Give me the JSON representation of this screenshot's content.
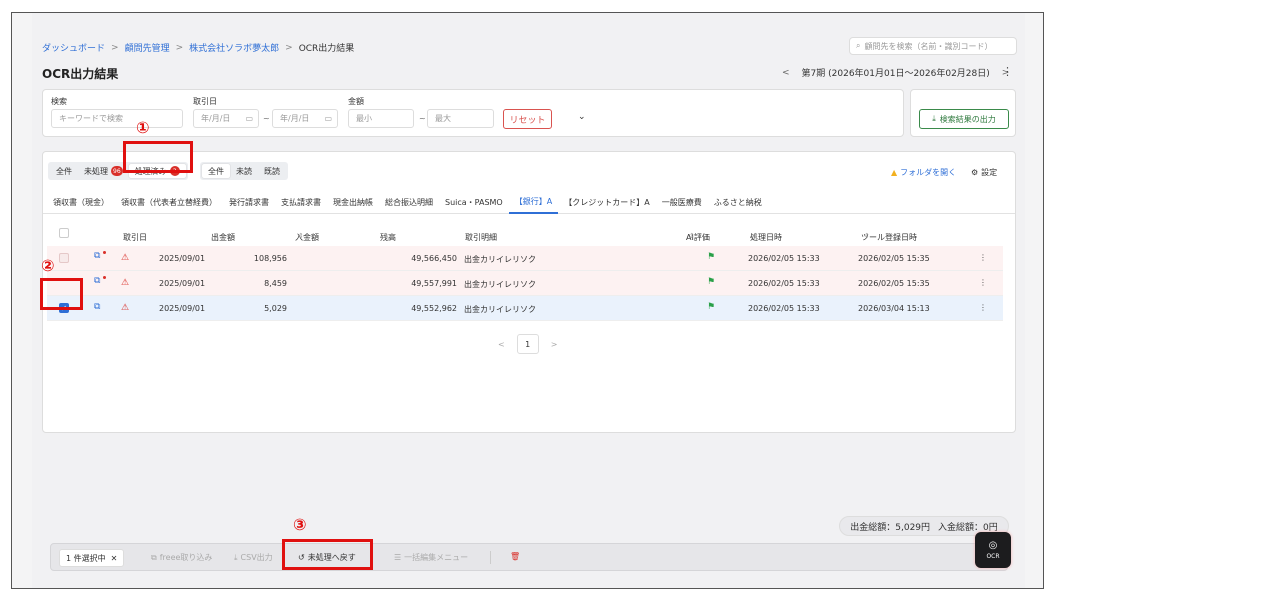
{
  "breadcrumb": {
    "items": [
      "ダッシュボード",
      "顧問先管理",
      "株式会社ソラボ夢太郎"
    ],
    "current": "OCR出力結果",
    "separator": ">"
  },
  "client_search": {
    "placeholder": "顧問先を検索（名前・識別コード）"
  },
  "page_title": "OCR出力結果",
  "period": {
    "prev": "<",
    "label": "第7期 (2026年01月01日〜2026年02月28日)",
    "next": ">"
  },
  "filters": {
    "keyword_label": "検索",
    "keyword_placeholder": "キーワードで検索",
    "date_label": "取引日",
    "date_from": "年/月/日",
    "date_to": "年/月/日",
    "amount_label": "金額",
    "amount_min": "最小",
    "amount_max": "最大",
    "range_sep": "~",
    "reset": "リセット",
    "export": "検索結果の出力"
  },
  "status_tabs": [
    {
      "label": "全件",
      "badge": ""
    },
    {
      "label": "未処理",
      "badge": "96"
    },
    {
      "label": "処理済み",
      "badge": "3"
    }
  ],
  "read_tabs": [
    "全件",
    "未読",
    "既読"
  ],
  "folder_link": "フォルダを開く",
  "settings_label": "設定",
  "categories": [
    "領収書（現金）",
    "領収書（代表者立替経費）",
    "発行請求書",
    "支払請求書",
    "現金出納帳",
    "総合振込明細",
    "Suica・PASMO",
    "【銀行】A",
    "【クレジットカード】A",
    "一般医療費",
    "ふるさと納税"
  ],
  "active_category": "【銀行】A",
  "table": {
    "headers": [
      "取引日",
      "出金額",
      "入金額",
      "残高",
      "取引明細",
      "AI評価",
      "処理日時",
      "ツール登録日時"
    ],
    "sort_icon": "⇕",
    "rows": [
      {
        "date": "2025/09/01",
        "out": "108,956",
        "in": "",
        "balance": "49,566,450",
        "desc": "出金カリイレリソク",
        "processed": "2026/02/05 15:33",
        "registered": "2026/02/05 15:35"
      },
      {
        "date": "2025/09/01",
        "out": "8,459",
        "in": "",
        "balance": "49,557,991",
        "desc": "出金カリイレリソク",
        "processed": "2026/02/05 15:33",
        "registered": "2026/02/05 15:35"
      },
      {
        "date": "2025/09/01",
        "out": "5,029",
        "in": "",
        "balance": "49,552,962",
        "desc": "出金カリイレリソク",
        "processed": "2026/02/05 15:33",
        "registered": "2026/03/04 15:13"
      }
    ]
  },
  "pagination": {
    "prev": "<",
    "current": "1",
    "next": ">"
  },
  "totals": {
    "out": "出金総額：5,029円",
    "in": "入金総額：0円"
  },
  "bottom_bar": {
    "selected": "1 件選択中",
    "clear": "✕",
    "freee": "freee取り込み",
    "csv": "CSV出力",
    "revert": "未処理へ戻す",
    "bulk_edit": "一括編集メニュー"
  },
  "ocr_button": "OCR",
  "annotations": [
    "①",
    "②",
    "③"
  ],
  "colors": {
    "accent": "#2f6fd6",
    "danger": "#d9302a",
    "success": "#2aa049",
    "annotation": "#e0100f"
  }
}
